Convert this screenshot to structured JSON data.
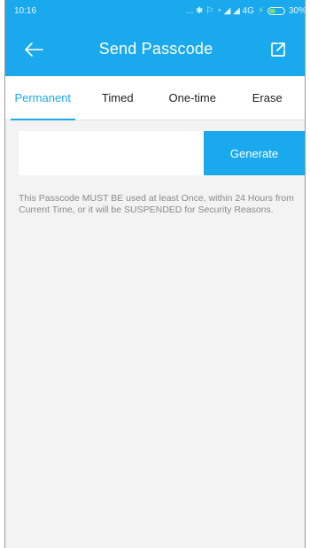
{
  "status_bar": {
    "time": "10:16",
    "icons_text": "... ✱ ⚐ ◔ ◢ ◢ 4G",
    "battery": "30%"
  },
  "header": {
    "title": "Send Passcode",
    "back_icon": "arrow-left-icon",
    "share_icon": "external-link-icon"
  },
  "tabs": [
    {
      "label": "Permanent",
      "active": true
    },
    {
      "label": "Timed",
      "active": false
    },
    {
      "label": "One-time",
      "active": false
    },
    {
      "label": "Erase",
      "active": false
    }
  ],
  "form": {
    "passcode_value": "",
    "generate_label": "Generate"
  },
  "notice": "This Passcode MUST BE used at least Once, within 24 Hours from Current Time, or it will be SUSPENDED for Security Reasons.",
  "colors": {
    "accent": "#1aa9ec",
    "background": "#f3f3f3",
    "notice_text": "#8a8a8a"
  }
}
